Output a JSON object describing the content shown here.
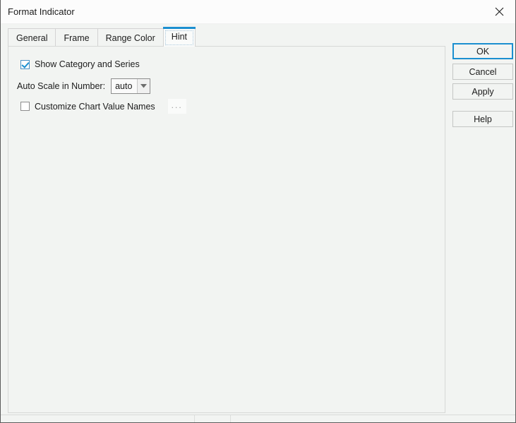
{
  "window": {
    "title": "Format Indicator",
    "close_icon": "close-icon"
  },
  "tabs": [
    {
      "label": "General",
      "active": false
    },
    {
      "label": "Frame",
      "active": false
    },
    {
      "label": "Range Color",
      "active": false
    },
    {
      "label": "Hint",
      "active": true
    }
  ],
  "panel": {
    "show_category_and_series": {
      "label": "Show Category and Series",
      "checked": true
    },
    "auto_scale": {
      "label": "Auto Scale in Number:",
      "value": "auto",
      "options": [
        "auto"
      ],
      "arrow_icon": "chevron-down-icon"
    },
    "customize_chart_value_names": {
      "label": "Customize Chart Value Names",
      "checked": false,
      "browse_label": "..."
    }
  },
  "buttons": {
    "ok": "OK",
    "cancel": "Cancel",
    "apply": "Apply",
    "help": "Help"
  },
  "colors": {
    "accent": "#1b8fd0",
    "panel_bg": "#f2f4f2",
    "titlebar_bg": "#fcfcfc",
    "border": "#d3d3d3"
  }
}
